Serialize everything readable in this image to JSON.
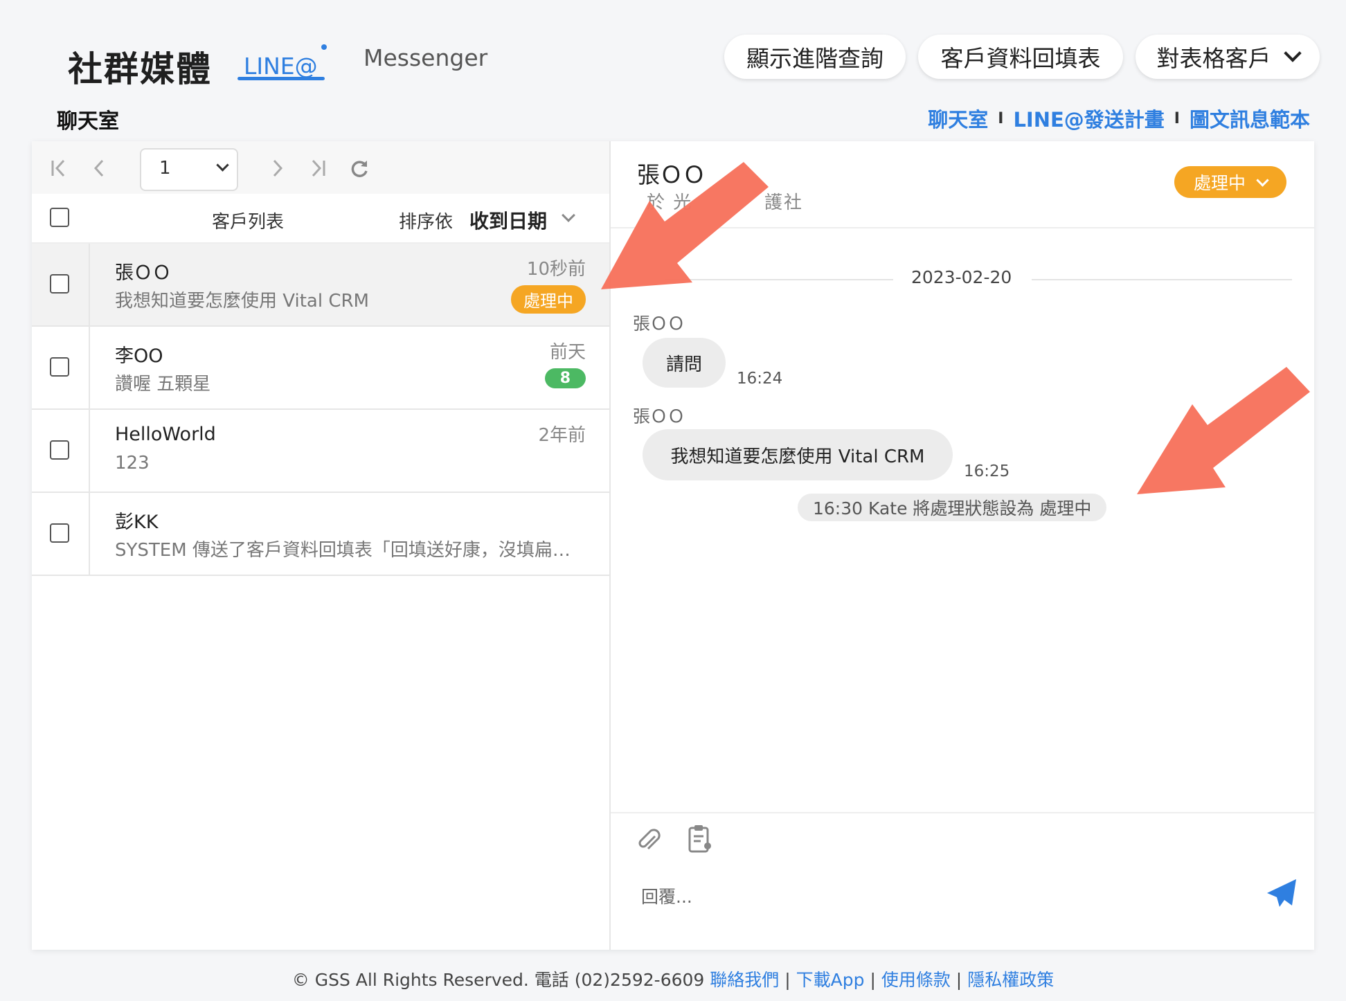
{
  "header": {
    "brand": "社群媒體",
    "tabs": [
      {
        "label": "LINE@",
        "active": true
      },
      {
        "label": "Messenger",
        "active": false
      }
    ],
    "buttons": {
      "advanced_query": "顯示進階查詢",
      "customer_form": "客戶資料回填表",
      "target_customer": "對表格客戶"
    },
    "section_title": "聊天室",
    "links": [
      "聊天室",
      "LINE@發送計畫",
      "圖文訊息範本"
    ],
    "link_separator": "I"
  },
  "toolbar": {
    "page_value": "1"
  },
  "list": {
    "header_label": "客戶列表",
    "sort_prefix": "排序依",
    "sort_value": "收到日期",
    "rows": [
      {
        "name": "張ＯＯ",
        "preview": "我想知道要怎麼使用 Vital CRM",
        "time": "10秒前",
        "badge": "處理中",
        "selected": true
      },
      {
        "name": "李OO",
        "preview": "讚喔 五顆星",
        "time": "前天",
        "badge": "8"
      },
      {
        "name": "HelloWorld",
        "preview": "123",
        "time": "2年前"
      },
      {
        "name": "彭KK",
        "preview": "SYSTEM 傳送了客戶資料回填表「回填送好康，沒填扁…",
        "time": ""
      }
    ]
  },
  "chat": {
    "name": "張ＯＯ",
    "subtitle_left": "於 光",
    "subtitle_right": "護社",
    "status": "處理中",
    "date": "2023-02-20",
    "messages": [
      {
        "sender": "張ＯＯ",
        "text": "請問",
        "time": "16:24"
      },
      {
        "sender": "張ＯＯ",
        "text": "我想知道要怎麼使用 Vital CRM",
        "time": "16:25"
      }
    ],
    "system_note": "16:30  Kate 將處理狀態設為 處理中",
    "reply_placeholder": "回覆..."
  },
  "footer": {
    "copyright": "© GSS All Rights Reserved. 電話 (02)2592-6609",
    "links": [
      "聯絡我們",
      "下載App",
      "使用條款",
      "隱私權政策"
    ],
    "sep": "|"
  },
  "colors": {
    "accent": "#2f7fe0",
    "status_orange": "#f5a623",
    "badge_green": "#4cb963",
    "arrow": "#f7705a"
  }
}
